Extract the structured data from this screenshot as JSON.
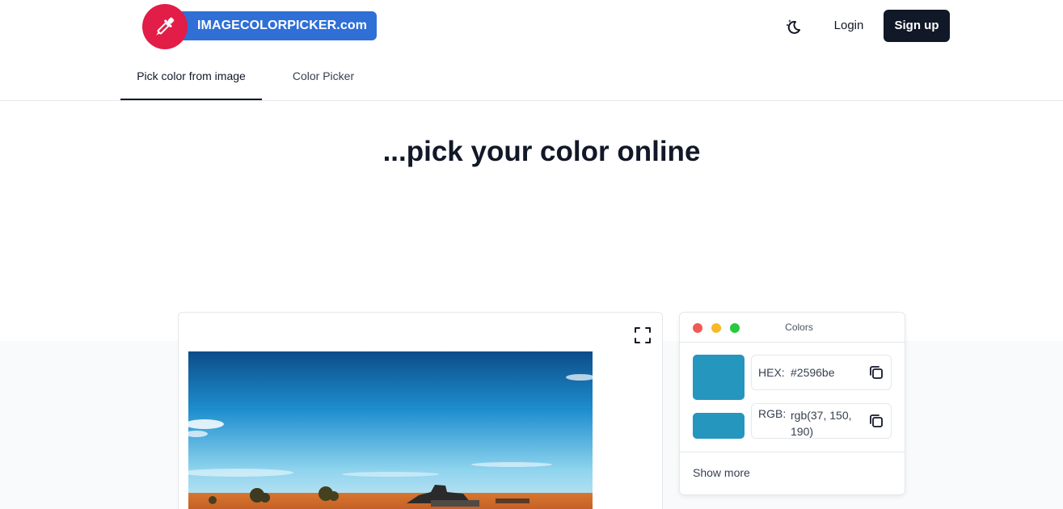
{
  "header": {
    "logo_text": "IMAGECOLORPICKER.com",
    "theme_icon": "moon-icon",
    "login_label": "Login",
    "signup_label": "Sign up"
  },
  "tabs": [
    {
      "label": "Pick color from image",
      "active": true
    },
    {
      "label": "Color Picker",
      "active": false
    }
  ],
  "headline": "...pick your color online",
  "image_panel": {
    "fullscreen_icon": "fullscreen-icon"
  },
  "colors_panel": {
    "title": "Colors",
    "hex_label": "HEX:",
    "hex_value": "#2596be",
    "rgb_label": "RGB:",
    "rgb_value": "rgb(37, 150, 190)",
    "picked_color": "#2596be",
    "copy_icon": "copy-icon",
    "show_more_label": "Show more"
  },
  "colors": {
    "brand_red": "#e11d48",
    "brand_blue": "#2f6fd6",
    "dark": "#111827"
  }
}
